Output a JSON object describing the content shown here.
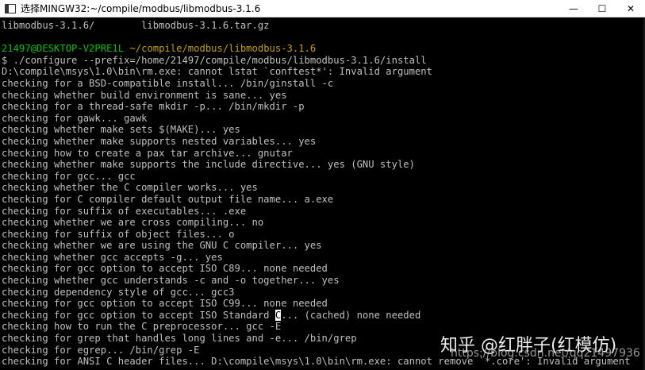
{
  "window": {
    "title": "选择MINGW32:~/compile/modbus/libmodbus-3.1.6",
    "icon": "terminal-icon",
    "controls": {
      "minimize": "—",
      "maximize": "☐",
      "close": "✕"
    }
  },
  "terminal": {
    "top_line": "libmodbus-3.1.6/        libmodbus-3.1.6.tar.gz",
    "blank": "",
    "prompt_user": "21497@DESKTOP-V2PRE1L",
    "prompt_path": "~/compile/modbus/libmodbus-3.1.6",
    "command": "$ ./configure --prefix=/home/21497/compile/modbus/libmodbus-3.1.6/install",
    "lines": [
      "D:\\compile\\msys\\1.0\\bin\\rm.exe: cannot lstat `conftest*': Invalid argument",
      "checking for a BSD-compatible install... /bin/ginstall -c",
      "checking whether build environment is sane... yes",
      "checking for a thread-safe mkdir -p... /bin/mkdir -p",
      "checking for gawk... gawk",
      "checking whether make sets $(MAKE)... yes",
      "checking whether make supports nested variables... yes",
      "checking how to create a pax tar archive... gnutar",
      "checking whether make supports the include directive... yes (GNU style)",
      "checking for gcc... gcc",
      "checking whether the C compiler works... yes",
      "checking for C compiler default output file name... a.exe",
      "checking for suffix of executables... .exe",
      "checking whether we are cross compiling... no",
      "checking for suffix of object files... o",
      "checking whether we are using the GNU C compiler... yes",
      "checking whether gcc accepts -g... yes",
      "checking for gcc option to accept ISO C89... none needed",
      "checking whether gcc understands -c and -o together... yes",
      "checking dependency style of gcc... gcc3",
      "checking for gcc option to accept ISO C99... none needed"
    ],
    "cursor_line_before": "checking for gcc option to accept ISO Standard ",
    "cursor_char": "C",
    "cursor_line_after": "... (cached) none needed",
    "lines_after": [
      "checking how to run the C preprocessor... gcc -E",
      "checking for grep that handles long lines and -e... /bin/grep",
      "checking for egrep... /bin/grep -E",
      "checking for ANSI C header files... D:\\compile\\msys\\1.0\\bin\\rm.exe: cannot remove `*.core': Invalid argument"
    ]
  },
  "watermark": {
    "text": "知乎 @红胖子(红模仿)",
    "url": "https://blog.csdn.net/qq21497936"
  }
}
